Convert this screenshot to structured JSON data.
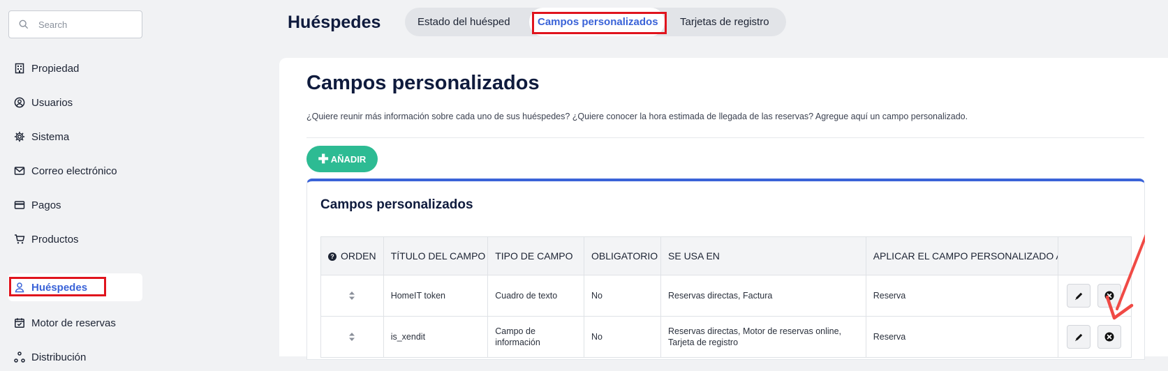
{
  "search": {
    "placeholder": "Search"
  },
  "sidebar": {
    "items": [
      {
        "label": "Propiedad",
        "icon": "building-icon"
      },
      {
        "label": "Usuarios",
        "icon": "user-circle-icon"
      },
      {
        "label": "Sistema",
        "icon": "gear-icon"
      },
      {
        "label": "Correo electrónico",
        "icon": "mail-icon"
      },
      {
        "label": "Pagos",
        "icon": "credit-card-icon"
      },
      {
        "label": "Productos",
        "icon": "cart-icon"
      },
      {
        "label": "Huéspedes",
        "icon": "user-icon",
        "active": true
      },
      {
        "label": "Motor de reservas",
        "icon": "calendar-check-icon"
      },
      {
        "label": "Distribución",
        "icon": "distribution-icon"
      }
    ]
  },
  "header": {
    "title": "Huéspedes",
    "tabs": [
      {
        "label": "Estado del huésped"
      },
      {
        "label": "Campos personalizados",
        "active": true
      },
      {
        "label": "Tarjetas de registro"
      }
    ]
  },
  "main": {
    "title": "Campos personalizados",
    "description": "¿Quiere reunir más información sobre cada uno de sus huéspedes? ¿Quiere conocer la hora estimada de llegada de las reservas? Agregue aquí un campo personalizado.",
    "add_button": "AÑADIR",
    "panel_title": "Campos personalizados",
    "table": {
      "columns": [
        "ORDEN",
        "TÍTULO DEL CAMPO",
        "TIPO DE CAMPO",
        "OBLIGATORIO",
        "SE USA EN",
        "APLICAR EL CAMPO PERSONALIZADO A",
        ""
      ],
      "rows": [
        {
          "title": "HomeIT token",
          "type": "Cuadro de texto",
          "required": "No",
          "used_in": "Reservas directas, Factura",
          "apply_to": "Reserva"
        },
        {
          "title": "is_xendit",
          "type": "Campo de información",
          "required": "No",
          "used_in": "Reservas directas, Motor de reservas online, Tarjeta de registro",
          "apply_to": "Reserva"
        }
      ]
    }
  },
  "colors": {
    "accent": "#3a63d8",
    "add_button": "#2dbb93",
    "highlight": "#e0141d",
    "arrow": "#f04a45"
  }
}
